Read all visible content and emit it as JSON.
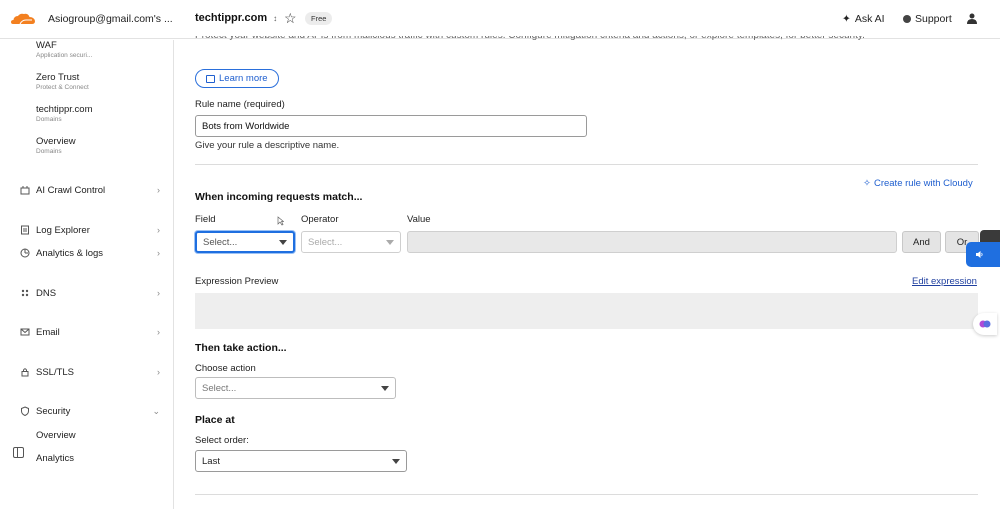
{
  "topbar": {
    "account": "Asiogroup@gmail.com's ...",
    "domain": "techtippr.com",
    "plan_badge": "Free",
    "ask_ai": "Ask AI",
    "support": "Support"
  },
  "sidebar": {
    "sub_items": [
      {
        "title": "WAF",
        "subtitle": "Application securi..."
      },
      {
        "title": "Zero Trust",
        "subtitle": "Protect & Connect"
      },
      {
        "title": "techtippr.com",
        "subtitle": "Domains"
      },
      {
        "title": "Overview",
        "subtitle": "Domains"
      }
    ],
    "nav": [
      {
        "label": "AI Crawl Control",
        "icon": "crawl-icon"
      },
      {
        "label": "Log Explorer",
        "icon": "log-icon"
      },
      {
        "label": "Analytics & logs",
        "icon": "analytics-icon"
      },
      {
        "label": "DNS",
        "icon": "dns-icon"
      },
      {
        "label": "Email",
        "icon": "email-icon"
      },
      {
        "label": "SSL/TLS",
        "icon": "lock-icon"
      },
      {
        "label": "Security",
        "icon": "shield-icon"
      }
    ],
    "security_sub": [
      "Overview",
      "Analytics"
    ]
  },
  "main": {
    "intro_text": "Protect your website and APIs from malicious traffic with custom rules. Configure mitigation criteria and actions, or explore templates, for better security.",
    "learn_more": "Learn more",
    "rule_name_label": "Rule name (required)",
    "rule_name_value": "Bots from Worldwide",
    "rule_name_help": "Give your rule a descriptive name.",
    "match_heading": "When incoming requests match...",
    "create_cloudy": "Create rule with Cloudy",
    "field_label": "Field",
    "operator_label": "Operator",
    "value_label": "Value",
    "field_placeholder": "Select...",
    "operator_placeholder": "Select...",
    "and_button": "And",
    "or_button": "Or",
    "expression_label": "Expression Preview",
    "edit_expression": "Edit expression",
    "action_heading": "Then take action...",
    "choose_action_label": "Choose action",
    "action_placeholder": "Select...",
    "place_heading": "Place at",
    "order_label": "Select order:",
    "order_value": "Last"
  },
  "colors": {
    "accent": "#1f6fe0",
    "link": "#1f5fcf",
    "brand_orange": "#f38020"
  }
}
